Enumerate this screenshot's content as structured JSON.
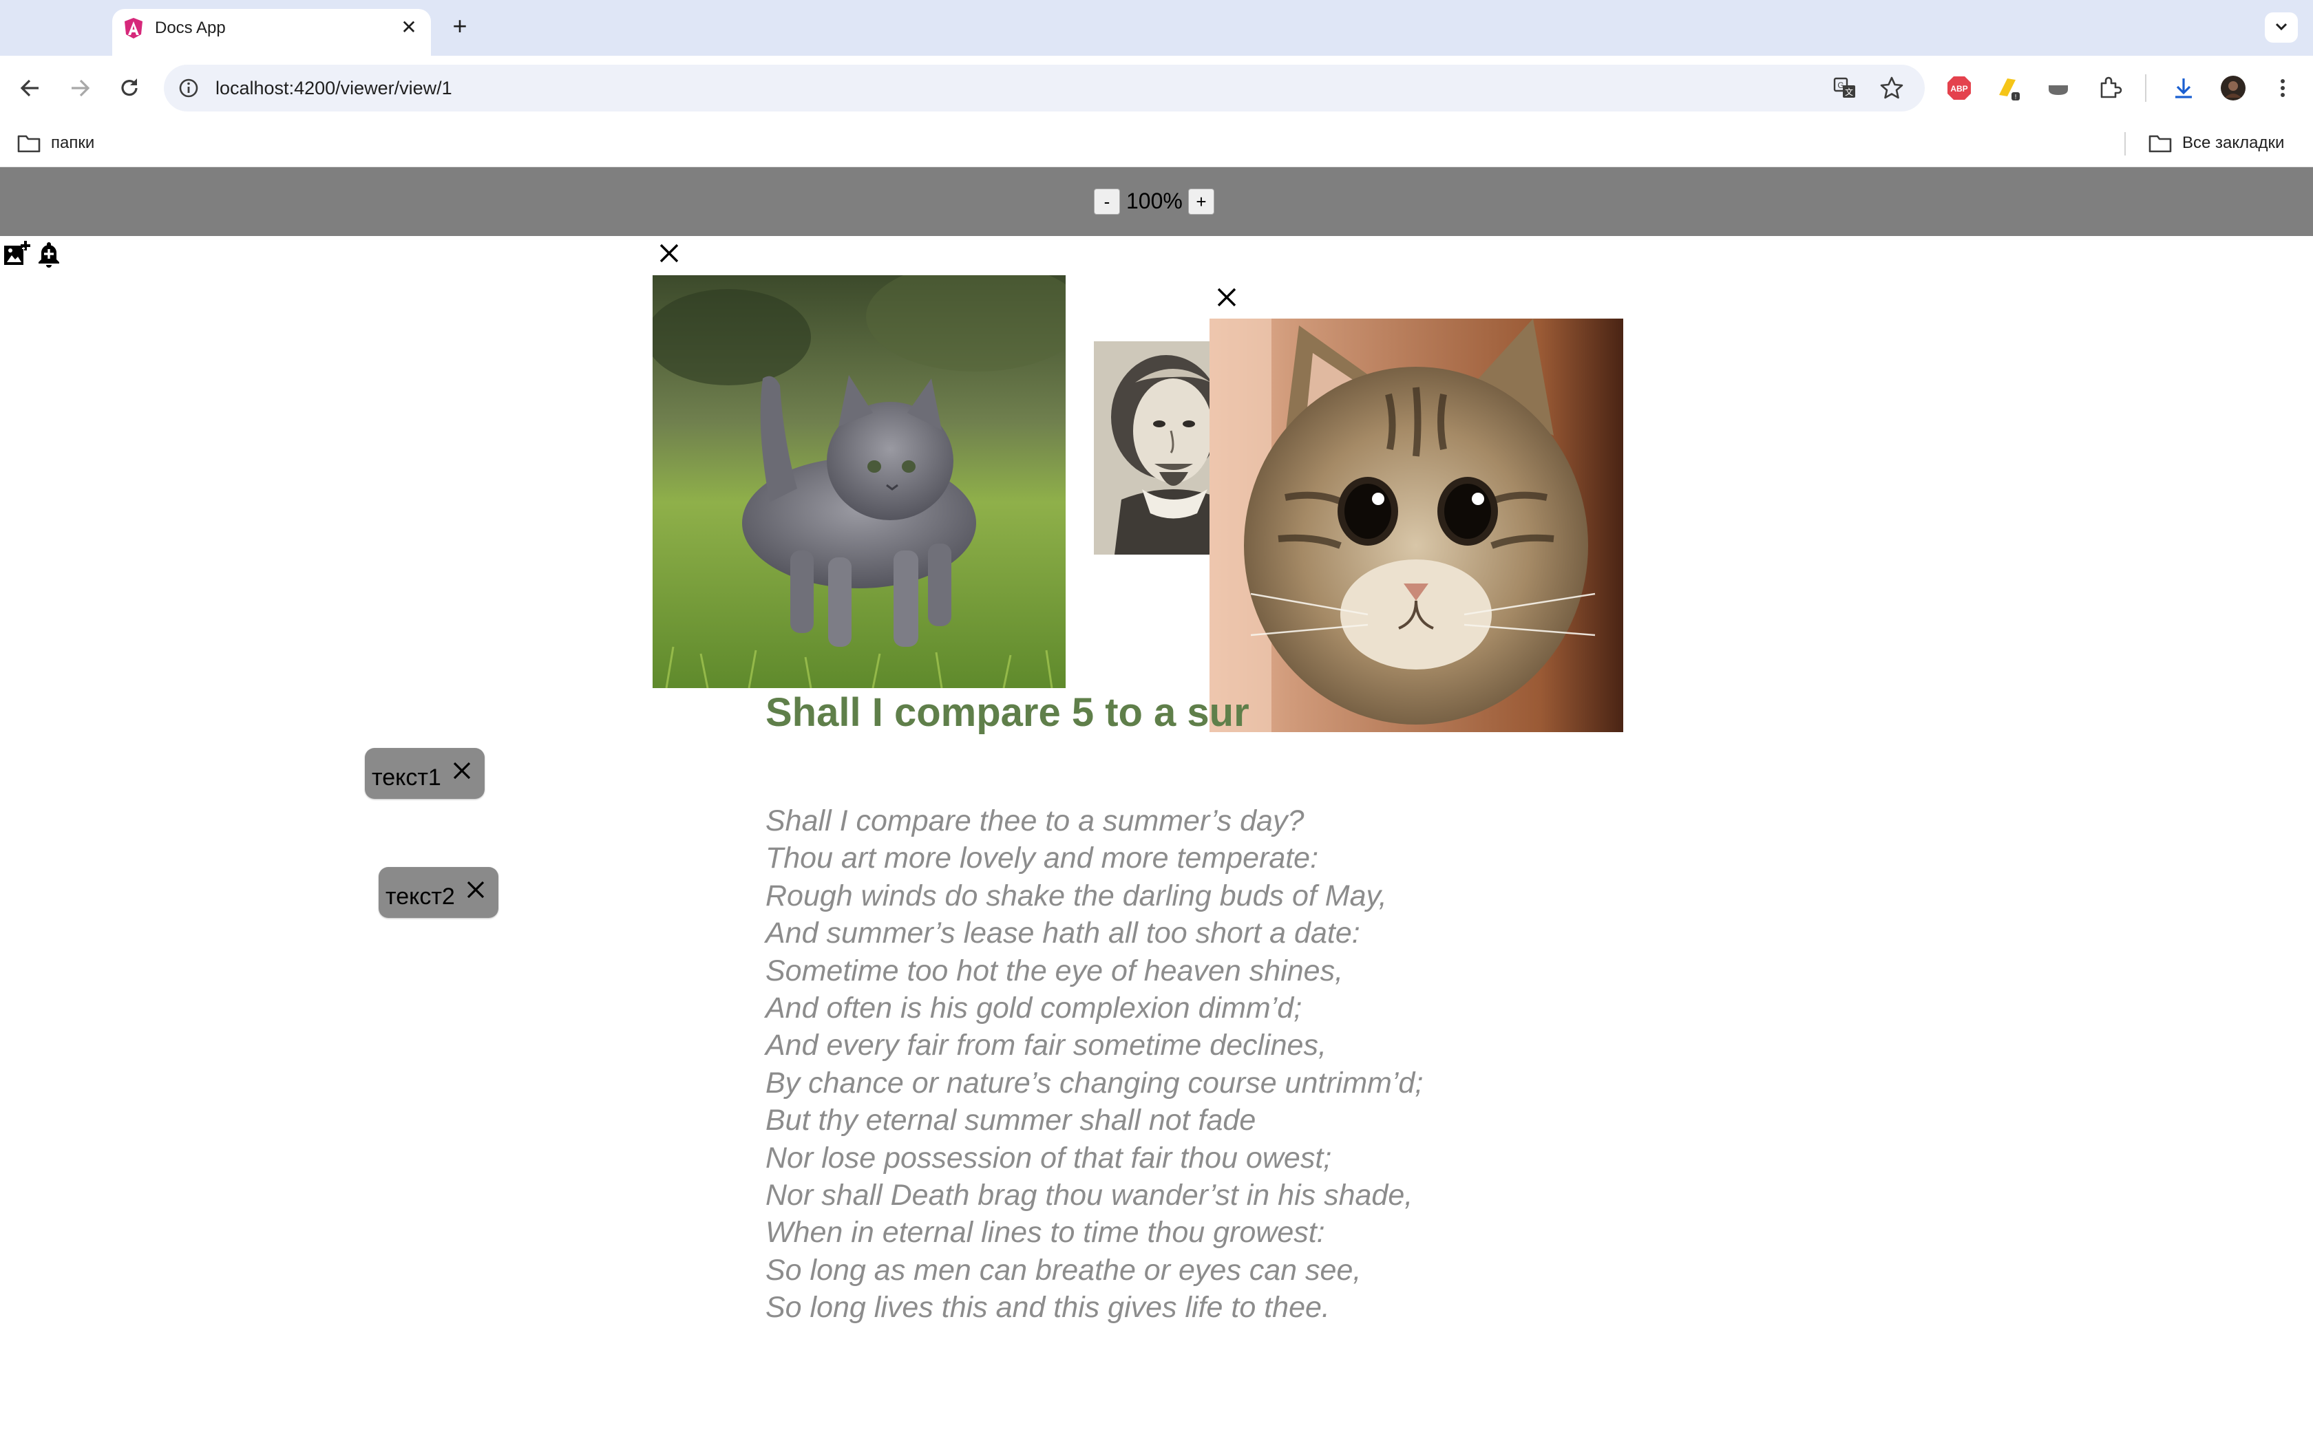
{
  "browser": {
    "tab_title": "Docs App",
    "url": "localhost:4200/viewer/view/1",
    "bookmark_folder": "папки",
    "all_bookmarks": "Все закладки"
  },
  "viewer": {
    "zoom_minus": "-",
    "zoom_value": "100%",
    "zoom_plus": "+"
  },
  "document": {
    "heading": "Shall I compare 5 to a sur",
    "poem": [
      "Shall I compare thee to a summer’s day?",
      "Thou art more lovely and more temperate:",
      "Rough winds do shake the darling buds of May,",
      "And summer’s lease hath all too short a date:",
      "Sometime too hot the eye of heaven shines,",
      "And often is his gold complexion dimm’d;",
      "And every fair from fair sometime declines,",
      "By chance or nature’s changing course untrimm’d;",
      "But thy eternal summer shall not fade",
      "Nor lose possession of that fair thou owest;",
      "Nor shall Death brag thou wander’st in his shade,",
      "When in eternal lines to time thou growest:",
      "So long as men can breathe or eyes can see,",
      "So long lives this and this gives life to thee."
    ]
  },
  "chips": [
    {
      "label": "текст1"
    },
    {
      "label": "текст2"
    }
  ],
  "colors": {
    "heading": "#5f7f4a",
    "poem": "#8c8c8c",
    "zoom_bar": "#7f7f7f",
    "chip": "#8a8a8a"
  },
  "icons": {
    "toolbar": [
      "add-image-icon",
      "add-notification-icon"
    ],
    "images": [
      "kitten-photo",
      "shakespeare-portrait",
      "tabby-cat-photo"
    ]
  }
}
